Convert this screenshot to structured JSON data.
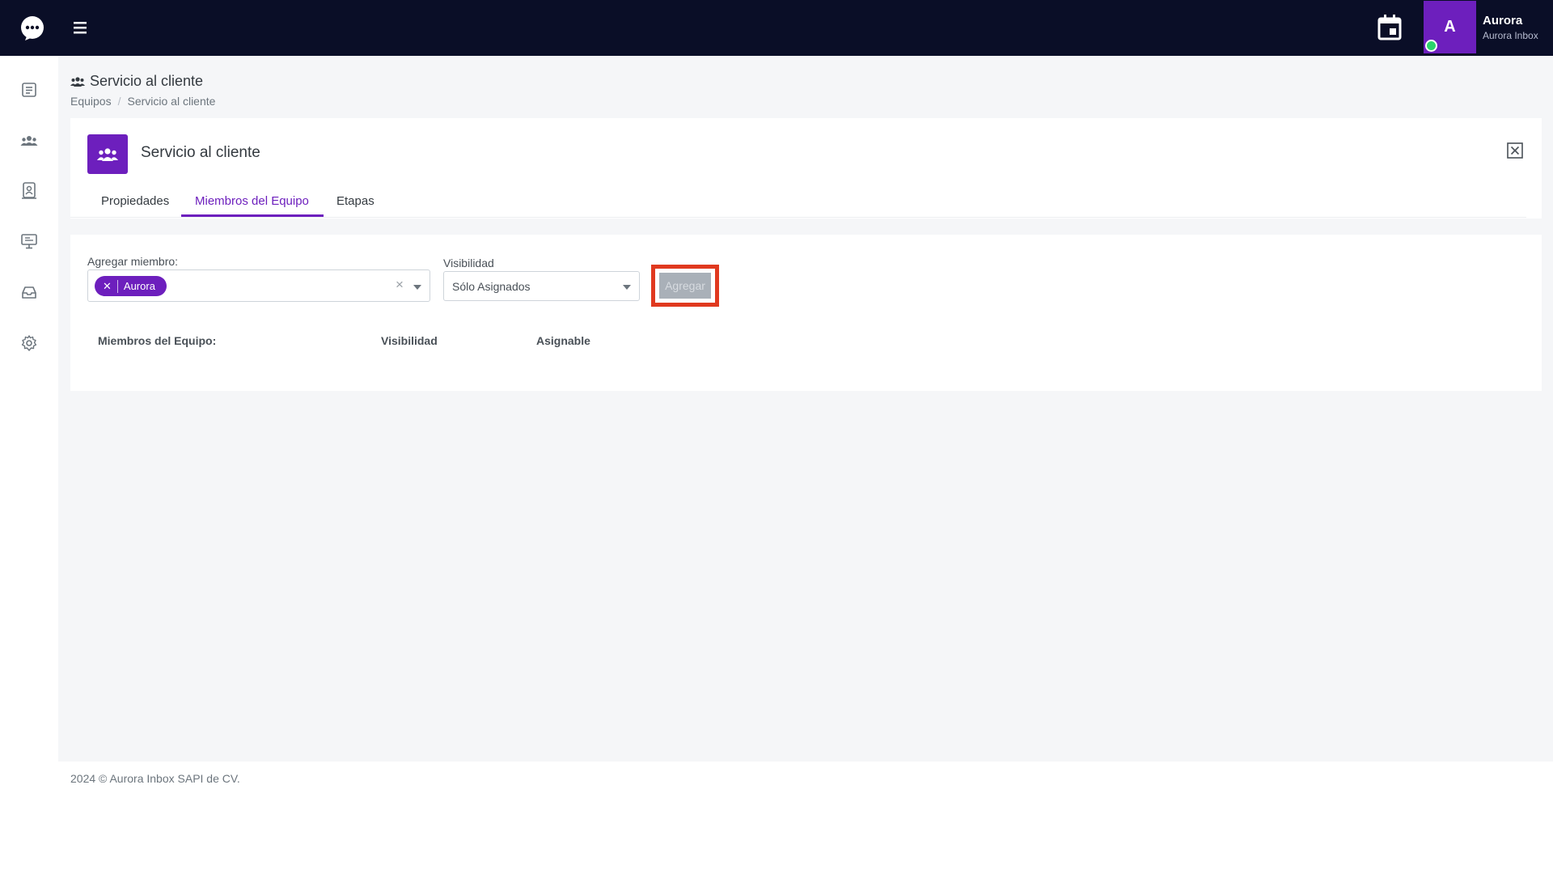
{
  "header": {
    "user_name": "Aurora",
    "user_company": "Aurora Inbox",
    "avatar_initial": "A"
  },
  "sidebar": {
    "items": [
      {
        "icon": "document-list-icon"
      },
      {
        "icon": "users-icon"
      },
      {
        "icon": "contact-card-icon"
      },
      {
        "icon": "monitor-icon"
      },
      {
        "icon": "inbox-tray-icon"
      },
      {
        "icon": "gear-icon"
      }
    ]
  },
  "page": {
    "title": "Servicio al cliente",
    "breadcrumb": [
      "Equipos",
      "Servicio al cliente"
    ]
  },
  "team": {
    "name": "Servicio al cliente",
    "tabs": [
      "Propiedades",
      "Miembros del Equipo",
      "Etapas"
    ],
    "active_tab": "Miembros del Equipo"
  },
  "form": {
    "add_member_label": "Agregar miembro:",
    "selected_member": "Aurora",
    "visibility_label": "Visibilidad",
    "visibility_value": "Sólo Asignados",
    "add_button": "Agregar"
  },
  "members_table": {
    "columns": [
      "Miembros del Equipo:",
      "Visibilidad",
      "Asignable"
    ]
  },
  "footer": {
    "text": "2024 © Aurora Inbox SAPI de CV."
  },
  "colors": {
    "brand_purple": "#6d1fbd",
    "topbar_bg": "#0a0e27",
    "highlight_red": "#e0391f",
    "online_green": "#2bd46b"
  }
}
